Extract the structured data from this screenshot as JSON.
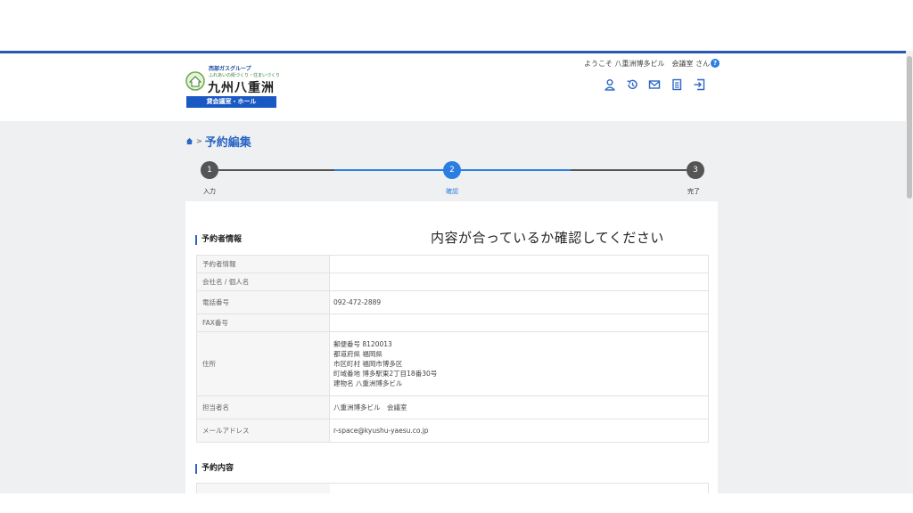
{
  "header": {
    "group_name": "西部ガスグループ",
    "slogan": "ふれあいの街づくり・住まいづくり",
    "company_name": "九州八重洲",
    "badge_label": "貸会議室・ホール",
    "welcome_text": "ようこそ 八重洲博多ビル　会議室 さん",
    "help_label": "?",
    "icons": [
      "user-icon",
      "history-icon",
      "mail-icon",
      "document-icon",
      "logout-icon"
    ]
  },
  "breadcrumb": {
    "separator": ">",
    "title": "予約編集"
  },
  "steps": [
    {
      "number": "1",
      "label": "入力",
      "state": "done"
    },
    {
      "number": "2",
      "label": "確認",
      "state": "active"
    },
    {
      "number": "3",
      "label": "完了",
      "state": "pending"
    }
  ],
  "message": "内容が合っているか確認してください",
  "sections": {
    "reserver_title": "予約者情報",
    "content_title": "予約内容"
  },
  "reserver_rows": [
    {
      "key": "予約者情報",
      "lines": [
        ""
      ]
    },
    {
      "key": "会社名 / 個人名",
      "lines": [
        ""
      ]
    },
    {
      "key": "電話番号",
      "lines": [
        "092-472-2889"
      ]
    },
    {
      "key": "FAX番号",
      "lines": [
        ""
      ]
    },
    {
      "key": "住所",
      "lines": [
        "郵便番号 8120013",
        "都道府県 福岡県",
        "市区町村 福岡市博多区",
        "町域番地 博多駅東2丁目18番30号",
        "建物名 八重洲博多ビル"
      ]
    },
    {
      "key": "担当者名",
      "lines": [
        "八重洲博多ビル　会議室"
      ]
    },
    {
      "key": "メールアドレス",
      "lines": [
        "r-space@kyushu-yaesu.co.jp"
      ]
    }
  ],
  "colors": {
    "accent": "#2b66c5",
    "progress_done": "#555555",
    "progress_active": "#2a7de1",
    "background": "#eef0f1"
  }
}
